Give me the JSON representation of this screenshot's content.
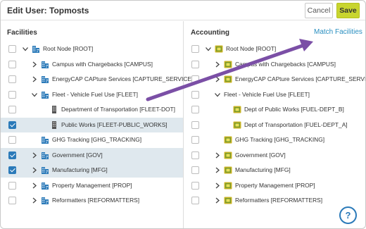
{
  "header": {
    "title": "Edit User: Topmosts",
    "cancel_label": "Cancel",
    "save_label": "Save"
  },
  "facilities": {
    "title": "Facilities",
    "rows": [
      {
        "label": "Root Node [ROOT]",
        "checked": false,
        "expander": "down",
        "icon": "building-icon"
      },
      {
        "label": "Campus with Chargebacks [CAMPUS]",
        "checked": false,
        "expander": "right",
        "icon": "building-icon"
      },
      {
        "label": "EnergyCAP CAPture Services [CAPTURE_SERVICES]",
        "checked": false,
        "expander": "right",
        "icon": "building-icon"
      },
      {
        "label": "Fleet - Vehicle Fuel Use [FLEET]",
        "checked": false,
        "expander": "down",
        "icon": "building-icon"
      },
      {
        "label": "Department of Transportation [FLEET-DOT]",
        "checked": false,
        "expander": "none",
        "icon": "tower-icon"
      },
      {
        "label": "Public Works [FLEET-PUBLIC_WORKS]",
        "checked": true,
        "expander": "none",
        "icon": "tower-icon"
      },
      {
        "label": "GHG Tracking [GHG_TRACKING]",
        "checked": false,
        "expander": "none",
        "icon": "building-icon"
      },
      {
        "label": "Government [GOV]",
        "checked": true,
        "expander": "right",
        "icon": "building-icon"
      },
      {
        "label": "Manufacturing [MFG]",
        "checked": true,
        "expander": "right",
        "icon": "building-icon"
      },
      {
        "label": "Property Management [PROP]",
        "checked": false,
        "expander": "right",
        "icon": "building-icon"
      },
      {
        "label": "Reformatters [REFORMATTERS]",
        "checked": false,
        "expander": "right",
        "icon": "building-icon"
      }
    ]
  },
  "accounting": {
    "title": "Accounting",
    "match_link": "Match Facilities",
    "rows": [
      {
        "label": "Root Node [ROOT]",
        "checked": false,
        "expander": "down",
        "icon": "cost-center-icon"
      },
      {
        "label": "Campus with Chargebacks [CAMPUS]",
        "checked": false,
        "expander": "right",
        "icon": "cost-center-icon"
      },
      {
        "label": "EnergyCAP CAPture Services [CAPTURE_SERVICES]",
        "checked": false,
        "expander": "right",
        "icon": "cost-center-icon"
      },
      {
        "label": "Fleet - Vehicle Fuel Use [FLEET]",
        "checked": false,
        "expander": "down",
        "icon": "none"
      },
      {
        "label": "Dept of Public Works [FUEL-DEPT_B]",
        "checked": false,
        "expander": "none",
        "icon": "cost-center-icon"
      },
      {
        "label": "Dept of Transportation [FUEL-DEPT_A]",
        "checked": false,
        "expander": "none",
        "icon": "cost-center-icon"
      },
      {
        "label": "GHG Tracking [GHG_TRACKING]",
        "checked": false,
        "expander": "none",
        "icon": "cost-center-icon"
      },
      {
        "label": "Government [GOV]",
        "checked": false,
        "expander": "right",
        "icon": "cost-center-icon"
      },
      {
        "label": "Manufacturing [MFG]",
        "checked": false,
        "expander": "right",
        "icon": "cost-center-icon"
      },
      {
        "label": "Property Management [PROP]",
        "checked": false,
        "expander": "right",
        "icon": "cost-center-icon"
      },
      {
        "label": "Reformatters [REFORMATTERS]",
        "checked": false,
        "expander": "right",
        "icon": "cost-center-icon"
      }
    ]
  },
  "help": {
    "label": "?"
  },
  "colors": {
    "accent": "#2b7ab9",
    "save": "#c8d52f",
    "selected_row": "#dfe8ee",
    "annotation_arrow": "#7b4fa6",
    "link": "#2a8fc0"
  }
}
